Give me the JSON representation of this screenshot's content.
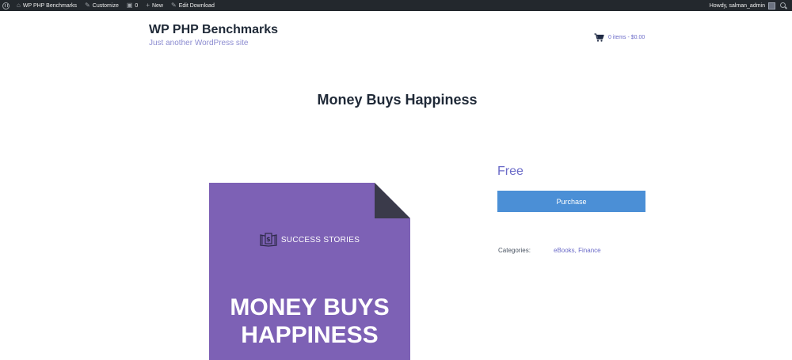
{
  "admin_bar": {
    "site_name": "WP PHP Benchmarks",
    "customize": "Customize",
    "comments_count": "0",
    "new": "New",
    "edit": "Edit Download",
    "greeting": "Howdy, salman_admin",
    "colors": {
      "background": "#23282d",
      "text": "#eeeeee"
    }
  },
  "header": {
    "site_title": "WP PHP Benchmarks",
    "tagline": "Just another WordPress site",
    "cart_text": "0 items - $0.00",
    "cart_icon": "shopping-cart-icon"
  },
  "product": {
    "title": "Money Buys Happiness",
    "price": "Free",
    "purchase_label": "Purchase",
    "categories_label": "Categories:",
    "categories_value": "eBooks, Finance",
    "image": {
      "badge_text": "SUCCESS STORIES",
      "title_line1": "MONEY BUYS",
      "title_line2": "HAPPINESS",
      "background_color": "#7d61b5"
    }
  },
  "colors": {
    "accent": "#6b6bc8",
    "button": "#4b8fd6"
  }
}
